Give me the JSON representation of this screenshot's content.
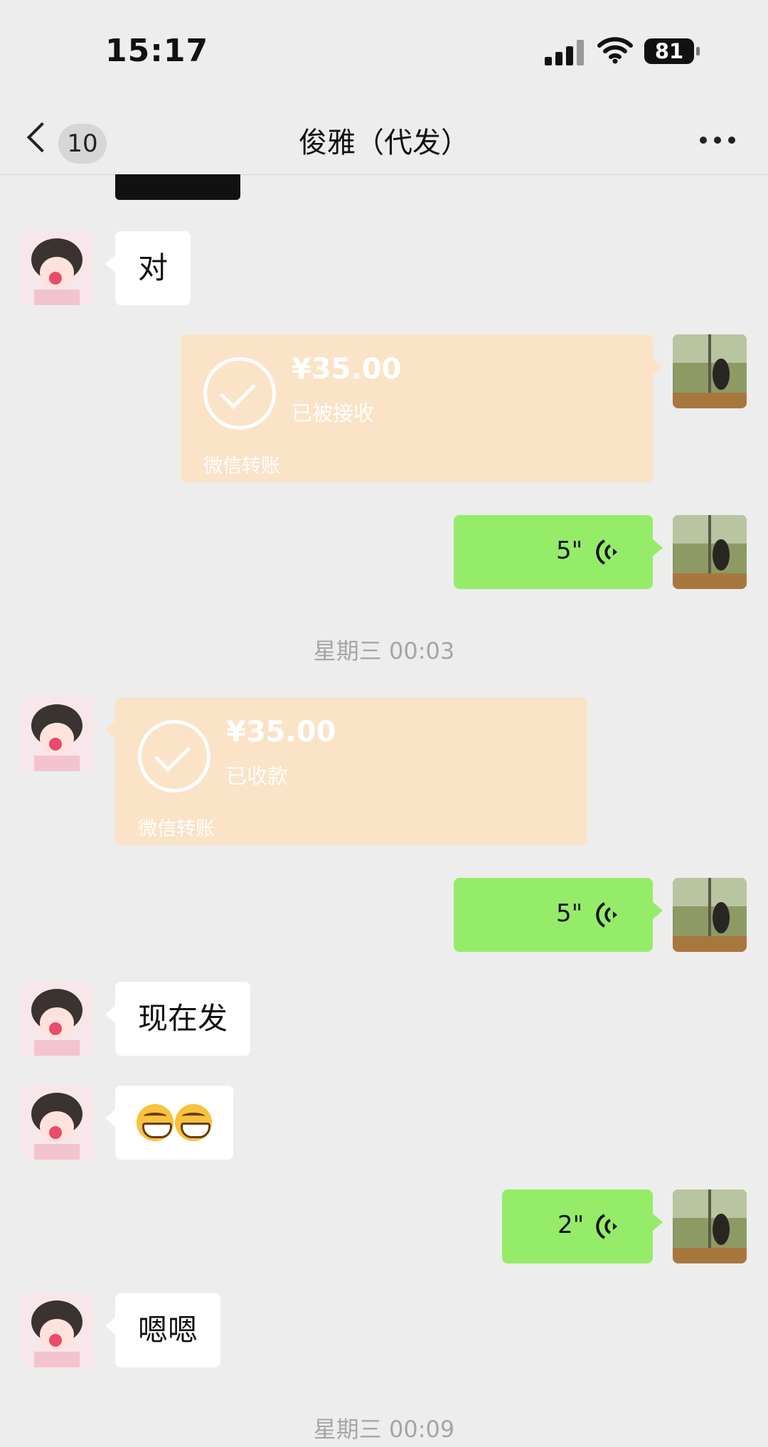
{
  "status_bar": {
    "time": "15:17",
    "battery": "81"
  },
  "nav": {
    "unread_count": "10",
    "title": "俊雅（代发）"
  },
  "messages": [
    {
      "text": "对"
    },
    {
      "amount": "¥35.00",
      "status": "已被接收",
      "footer": "微信转账"
    },
    {
      "voice_length": "5\""
    },
    {
      "timestamp": "星期三 00:03"
    },
    {
      "amount": "¥35.00",
      "status": "已收款",
      "footer": "微信转账"
    },
    {
      "voice_length": "5\""
    },
    {
      "text": "现在发"
    },
    {
      "emoji": "grinning-face-emoji x2"
    },
    {
      "voice_length": "2\""
    },
    {
      "text": "嗯嗯"
    },
    {
      "timestamp": "星期三 00:09"
    }
  ],
  "colors": {
    "background": "#ededed",
    "sent_bubble": "#95ec69",
    "received_bubble": "#ffffff",
    "transfer_bubble": "#fbe3c8"
  },
  "icons": [
    "back-chevron-icon",
    "more-dots-icon",
    "voice-wave-icon",
    "check-circle-icon",
    "signal-icon",
    "wifi-icon",
    "battery-icon"
  ]
}
